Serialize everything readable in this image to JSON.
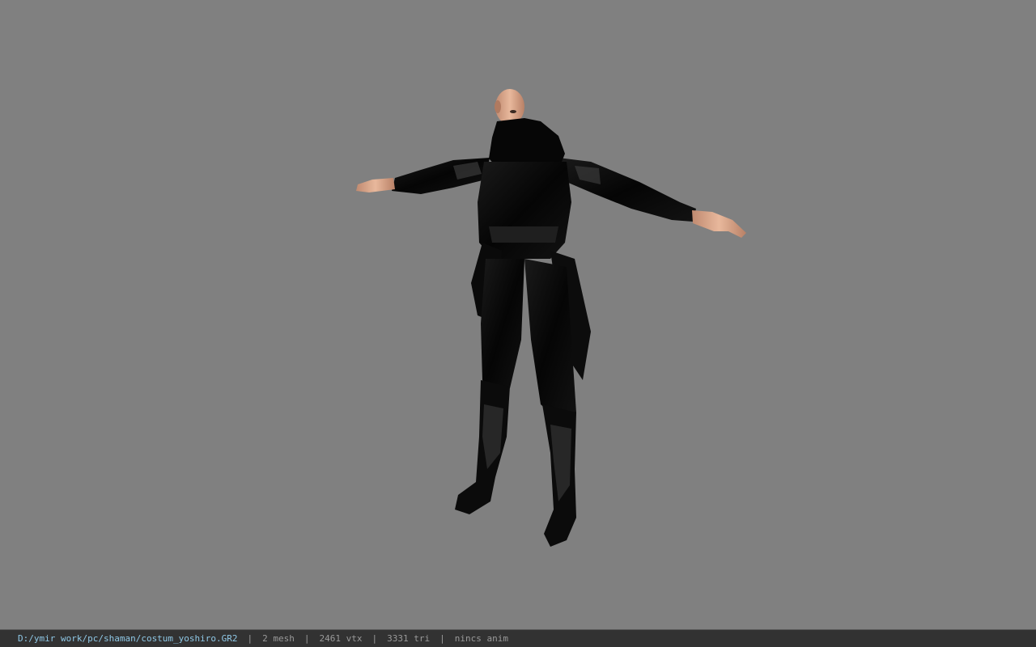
{
  "viewport": {
    "background_color": "#808080",
    "model_name": "character-model"
  },
  "status_bar": {
    "file_path": "D:/ymir work/pc/shaman/costum_yoshiro.GR2",
    "separator": "|",
    "mesh_count": "2 mesh",
    "vertex_count": "2461 vtx",
    "triangle_count": "3331 tri",
    "animation_status": "nincs anim",
    "path_color": "#8fc8e6",
    "text_color": "#9a9a9a",
    "background_color": "#323232"
  }
}
